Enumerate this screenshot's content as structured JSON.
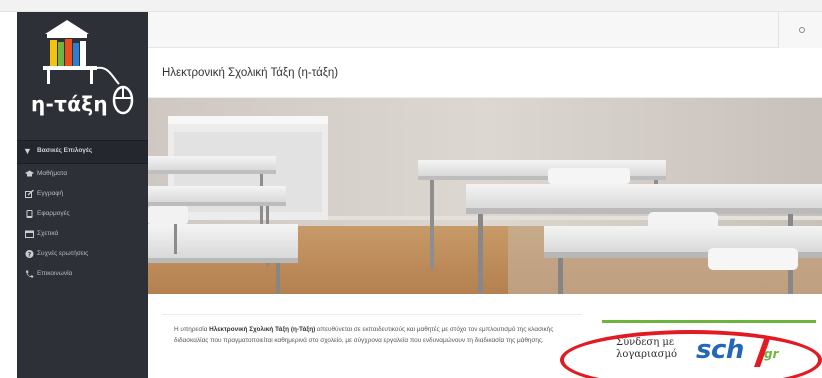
{
  "app": {
    "logo_text": "η-τάξη"
  },
  "header": {
    "page_title": "Ηλεκτρονική Σχολική Τάξη (η-τάξη)"
  },
  "sidebar": {
    "section_label": "Βασικές Επιλογές",
    "items": [
      {
        "label": "Μαθήματα",
        "icon": "graduation-cap-icon"
      },
      {
        "label": "Εγγραφή",
        "icon": "edit-icon"
      },
      {
        "label": "Εφαρμογές",
        "icon": "tablet-icon"
      },
      {
        "label": "Σχετικά",
        "icon": "calendar-icon"
      },
      {
        "label": "Συχνές ερωτήσεις",
        "icon": "question-circle-icon"
      },
      {
        "label": "Επικοινωνία",
        "icon": "phone-icon"
      }
    ]
  },
  "main": {
    "info_prefix": "Η υπηρεσία ",
    "info_bold": "Ηλεκτρονική Σχολική Τάξη (η-Τάξη)",
    "info_suffix": " απευθύνεται σε εκπαιδευτικούς και μαθητές με στόχο τον εμπλουτισμό της κλασικής διδασκαλίας που πραγματοποιείται καθημερινά στο σχολείο, με σύγχρονα εργαλεία που ενδυναμώνουν τη διαδικασία της μάθησης."
  },
  "login": {
    "label_line1": "Σύνδεση με",
    "label_line2": "λογαριασμό",
    "brand_main": "sch",
    "brand_suffix": "gr"
  },
  "colors": {
    "sidebar_bg": "#2d3037",
    "brand_blue": "#2466b7",
    "brand_green": "#6eb53f",
    "highlight_red": "#e21b23"
  }
}
